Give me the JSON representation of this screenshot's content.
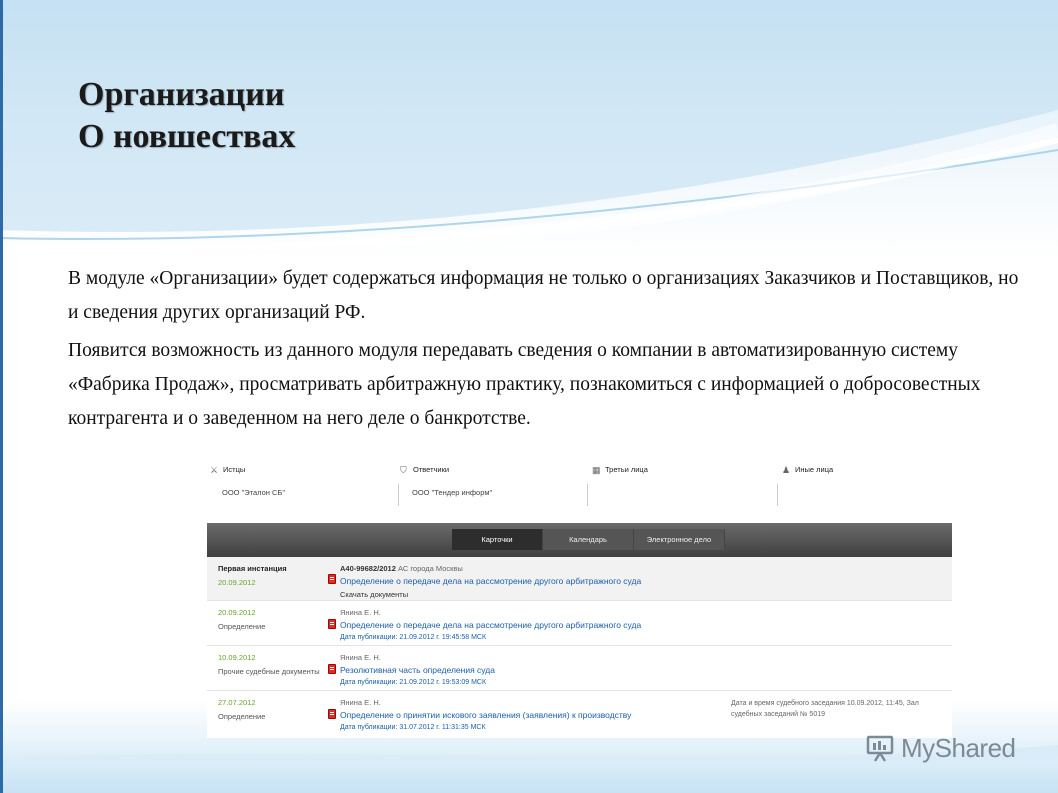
{
  "slide": {
    "title_line1": "Организации",
    "title_line2": "О новшествах",
    "paragraph1": "В модуле «Организации» будет содержаться информация не только о организациях Заказчиков и Поставщиков, но и сведения других организаций РФ.",
    "paragraph2": "Появится возможность из данного модуля  передавать сведения о компании в автоматизированную систему «Фабрика Продаж», просматривать арбитражную практику, познакомиться с информацией о добросовестных контрагента и о заведенном на него деле о банкротстве."
  },
  "parties": [
    {
      "label": "Истцы",
      "icon": "swords-icon",
      "value": "ООО \"Эталон СБ\""
    },
    {
      "label": "Ответчики",
      "icon": "shield-icon",
      "value": "ООО \"Тендер информ\""
    },
    {
      "label": "Третьи лица",
      "icon": "building-icon",
      "value": ""
    },
    {
      "label": "Иные лица",
      "icon": "person-icon",
      "value": ""
    }
  ],
  "tabs": [
    "Карточки",
    "Календарь",
    "Электронное дело"
  ],
  "active_tab": "Карточки",
  "rows": [
    {
      "left_head": "Первая инстанция",
      "date": "20.09.2012",
      "case": "А40-99682/2012",
      "court": "АС города Москвы",
      "doc": "Определение о передаче дела на рассмотрение другого арбитражного суда",
      "sub": "Скачать документы"
    },
    {
      "date": "20.09.2012",
      "type": "Определение",
      "judge": "Янина Е. Н.",
      "doc": "Определение о передаче дела на рассмотрение другого арбитражного суда",
      "pub": "Дата публикации: 21.09.2012 г. 19:45:58 МСК"
    },
    {
      "date": "10.09.2012",
      "type": "Прочие судебные документы",
      "judge": "Янина Е. Н.",
      "doc": "Резолютивная часть определения суда",
      "pub": "Дата публикации: 21.09.2012 г. 19:53:09 МСК"
    },
    {
      "date": "27.07.2012",
      "type": "Определение",
      "judge": "Янина Е. Н.",
      "doc": "Определение о принятии искового заявления (заявления) к производству",
      "pub": "Дата публикации: 31.07.2012 г. 11:31:35 МСК",
      "side": "Дата и время судебного заседания 10.09.2012, 11:45, Зал судебных заседаний № 5019"
    }
  ],
  "watermark": "MyShared",
  "colors": {
    "accent_blue": "#1b5fa8",
    "date_green": "#6aa32c",
    "tabbar_dark": "#3f3f3f"
  }
}
